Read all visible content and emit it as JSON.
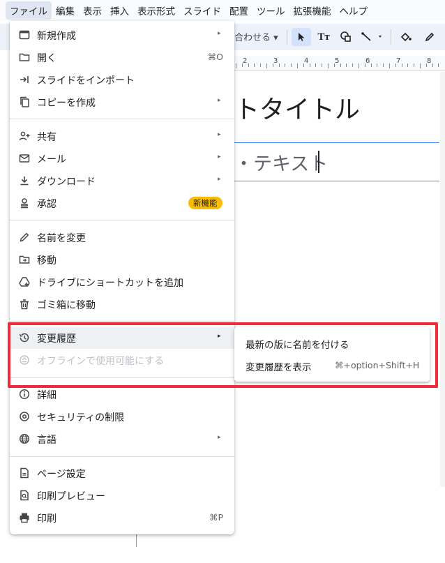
{
  "menubar": {
    "items": [
      "ファイル",
      "編集",
      "表示",
      "挿入",
      "表示形式",
      "スライド",
      "配置",
      "ツール",
      "拡張機能",
      "ヘルプ"
    ]
  },
  "toolbar": {
    "fit_label": "合わせる",
    "icons": [
      "cursor-icon",
      "text-box-icon",
      "shape-icon",
      "line-icon",
      "fill-color-icon",
      "pen-icon"
    ]
  },
  "ruler": {
    "numbers": [
      "2",
      "3",
      "4",
      "5",
      "6",
      "7",
      "8"
    ]
  },
  "slide": {
    "title": "トタイトル",
    "subtitle": "・テキスト"
  },
  "file_menu": {
    "items": [
      {
        "label": "新規作成",
        "icon": "new-icon",
        "arrow": "▸"
      },
      {
        "label": "開く",
        "icon": "folder-icon",
        "shortcut": "⌘O"
      },
      {
        "label": "スライドをインポート",
        "icon": "import-icon"
      },
      {
        "label": "コピーを作成",
        "icon": "copy-icon",
        "arrow": "▸"
      },
      {
        "label": "共有",
        "icon": "share-person-icon",
        "arrow": "▸"
      },
      {
        "label": "メール",
        "icon": "mail-icon",
        "arrow": "▸"
      },
      {
        "label": "ダウンロード",
        "icon": "download-icon",
        "arrow": "▸"
      },
      {
        "label": "承認",
        "icon": "approval-icon",
        "badge": "新機能"
      },
      {
        "label": "名前を変更",
        "icon": "pencil-icon"
      },
      {
        "label": "移動",
        "icon": "move-folder-icon"
      },
      {
        "label": "ドライブにショートカットを追加",
        "icon": "drive-shortcut-icon"
      },
      {
        "label": "ゴミ箱に移動",
        "icon": "trash-icon"
      },
      {
        "label": "変更履歴",
        "icon": "history-icon",
        "arrow": "▸"
      },
      {
        "label": "オフラインで使用可能にする",
        "icon": "offline-icon"
      },
      {
        "label": "詳細",
        "icon": "info-icon"
      },
      {
        "label": "セキュリティの制限",
        "icon": "security-icon"
      },
      {
        "label": "言語",
        "icon": "globe-icon",
        "arrow": "▸"
      },
      {
        "label": "ページ設定",
        "icon": "page-icon"
      },
      {
        "label": "印刷プレビュー",
        "icon": "print-preview-icon"
      },
      {
        "label": "印刷",
        "icon": "print-icon",
        "shortcut": "⌘P"
      }
    ]
  },
  "version_submenu": {
    "items": [
      {
        "label": "最新の版に名前を付ける"
      },
      {
        "label": "変更履歴を表示",
        "shortcut": "⌘+option+Shift+H"
      }
    ]
  },
  "colors": {
    "annotation": "#ef2b3b",
    "badge": "#fbbc04",
    "selection": "#4285f4"
  }
}
